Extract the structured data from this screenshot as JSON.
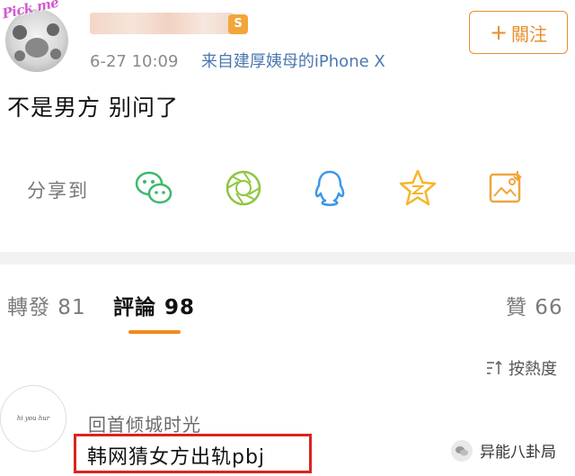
{
  "post": {
    "avatar_sticker": "Pick me",
    "vip_badge": "S",
    "meta_time": "6-27 10:09",
    "meta_source": "来自建厚姨母的iPhone X",
    "follow_label": "關注",
    "follow_plus": "+",
    "text": "不是男方 别问了"
  },
  "share": {
    "label": "分享到",
    "targets": [
      "wechat-icon",
      "moments-icon",
      "qq-icon",
      "qzone-icon",
      "save-image-icon"
    ],
    "colors": {
      "wechat": "#3cb96b",
      "moments": "#8ec63f",
      "qq": "#3a98e8",
      "qzone": "#f6b52a",
      "save": "#f0a53a"
    }
  },
  "tabs": {
    "repost": "轉發 81",
    "comments": "評論 98",
    "likes": "贊 66"
  },
  "sort": {
    "label": "按熱度"
  },
  "comment": {
    "avatar_text": "hi you hur",
    "name": "回首倾城时光",
    "text": "韩网猜女方出轨pbj"
  },
  "watermark": {
    "text": "异能八卦局"
  },
  "colors": {
    "accent": "#f08a1c",
    "highlight_box": "#d9241f",
    "link": "#4b78b0"
  }
}
